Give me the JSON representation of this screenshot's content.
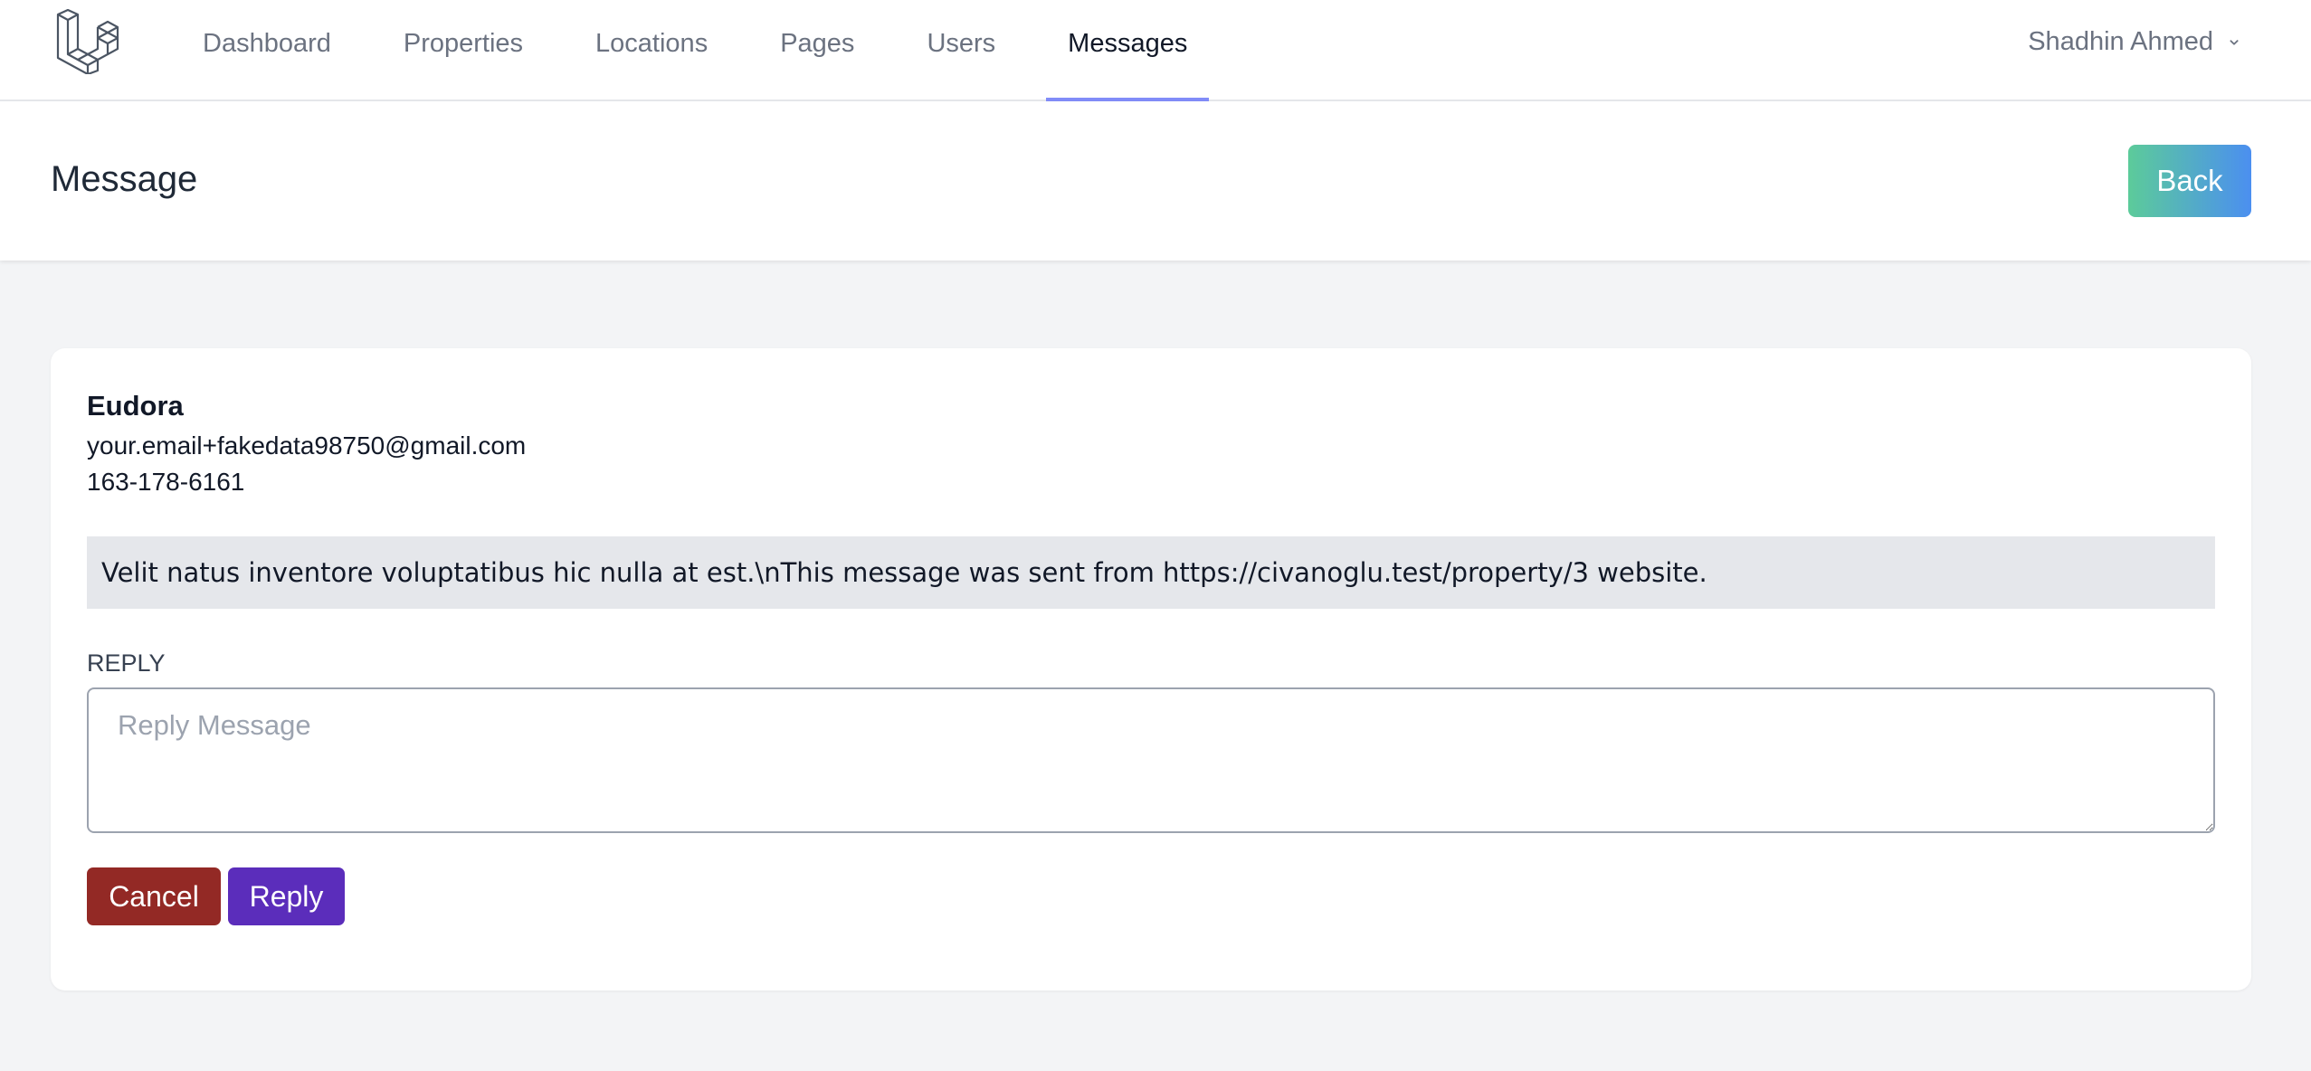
{
  "nav": {
    "logo_icon": "laravel-logo-icon",
    "items": [
      {
        "label": "Dashboard",
        "active": false
      },
      {
        "label": "Properties",
        "active": false
      },
      {
        "label": "Locations",
        "active": false
      },
      {
        "label": "Pages",
        "active": false
      },
      {
        "label": "Users",
        "active": false
      },
      {
        "label": "Messages",
        "active": true
      }
    ],
    "user_name": "Shadhin Ahmed",
    "user_menu_icon": "chevron-down-icon"
  },
  "header": {
    "title": "Message",
    "back_label": "Back"
  },
  "message": {
    "sender_name": "Eudora",
    "sender_email": "your.email+fakedata98750@gmail.com",
    "sender_phone": "163-178-6161",
    "body": "Velit natus inventore voluptatibus hic nulla at est.\\nThis message was sent from https://civanoglu.test/property/3 website."
  },
  "reply": {
    "label": "REPLY",
    "placeholder": "Reply Message",
    "value": "",
    "cancel_label": "Cancel",
    "submit_label": "Reply"
  },
  "colors": {
    "accent_underline": "#818cf8",
    "back_gradient_start": "#5ccb9a",
    "back_gradient_end": "#4b8ff0",
    "cancel": "#932925",
    "reply": "#5b2dbb",
    "background": "#f3f4f6"
  }
}
